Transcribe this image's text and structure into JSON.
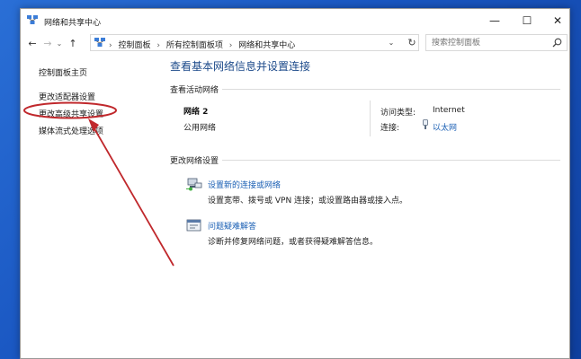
{
  "window": {
    "title": "网络和共享中心",
    "minimize_glyph": "—",
    "maximize_glyph": "☐",
    "close_glyph": "✕"
  },
  "nav": {
    "back_glyph": "←",
    "forward_glyph": "→",
    "recent_glyph": "⌄",
    "up_glyph": "↑",
    "breadcrumb": [
      "控制面板",
      "所有控制面板项",
      "网络和共享中心"
    ],
    "breadcrumb_sep": "›",
    "dropdown_glyph": "⌄",
    "refresh_glyph": "↻"
  },
  "search": {
    "placeholder": "搜索控制面板"
  },
  "sidebar": {
    "items": [
      {
        "label": "控制面板主页"
      },
      {
        "label": "更改适配器设置"
      },
      {
        "label": "更改高级共享设置"
      },
      {
        "label": "媒体流式处理选项"
      }
    ]
  },
  "main": {
    "title": "查看基本网络信息并设置连接",
    "active_section": "查看活动网络",
    "network": {
      "name": "网络 2",
      "type": "公用网络",
      "access_label": "访问类型:",
      "access_value": "Internet",
      "connection_label": "连接:",
      "connection_value": "以太网"
    },
    "change_section": "更改网络设置",
    "tasks": [
      {
        "title": "设置新的连接或网络",
        "desc": "设置宽带、拨号或 VPN 连接；或设置路由器或接入点。"
      },
      {
        "title": "问题疑难解答",
        "desc": "诊断并修复网络问题，或者获得疑难解答信息。"
      }
    ]
  },
  "colors": {
    "link": "#1a5fb4",
    "title": "#1c4a8a",
    "annotation": "#c0282c",
    "desktop": "#1a57c2"
  }
}
